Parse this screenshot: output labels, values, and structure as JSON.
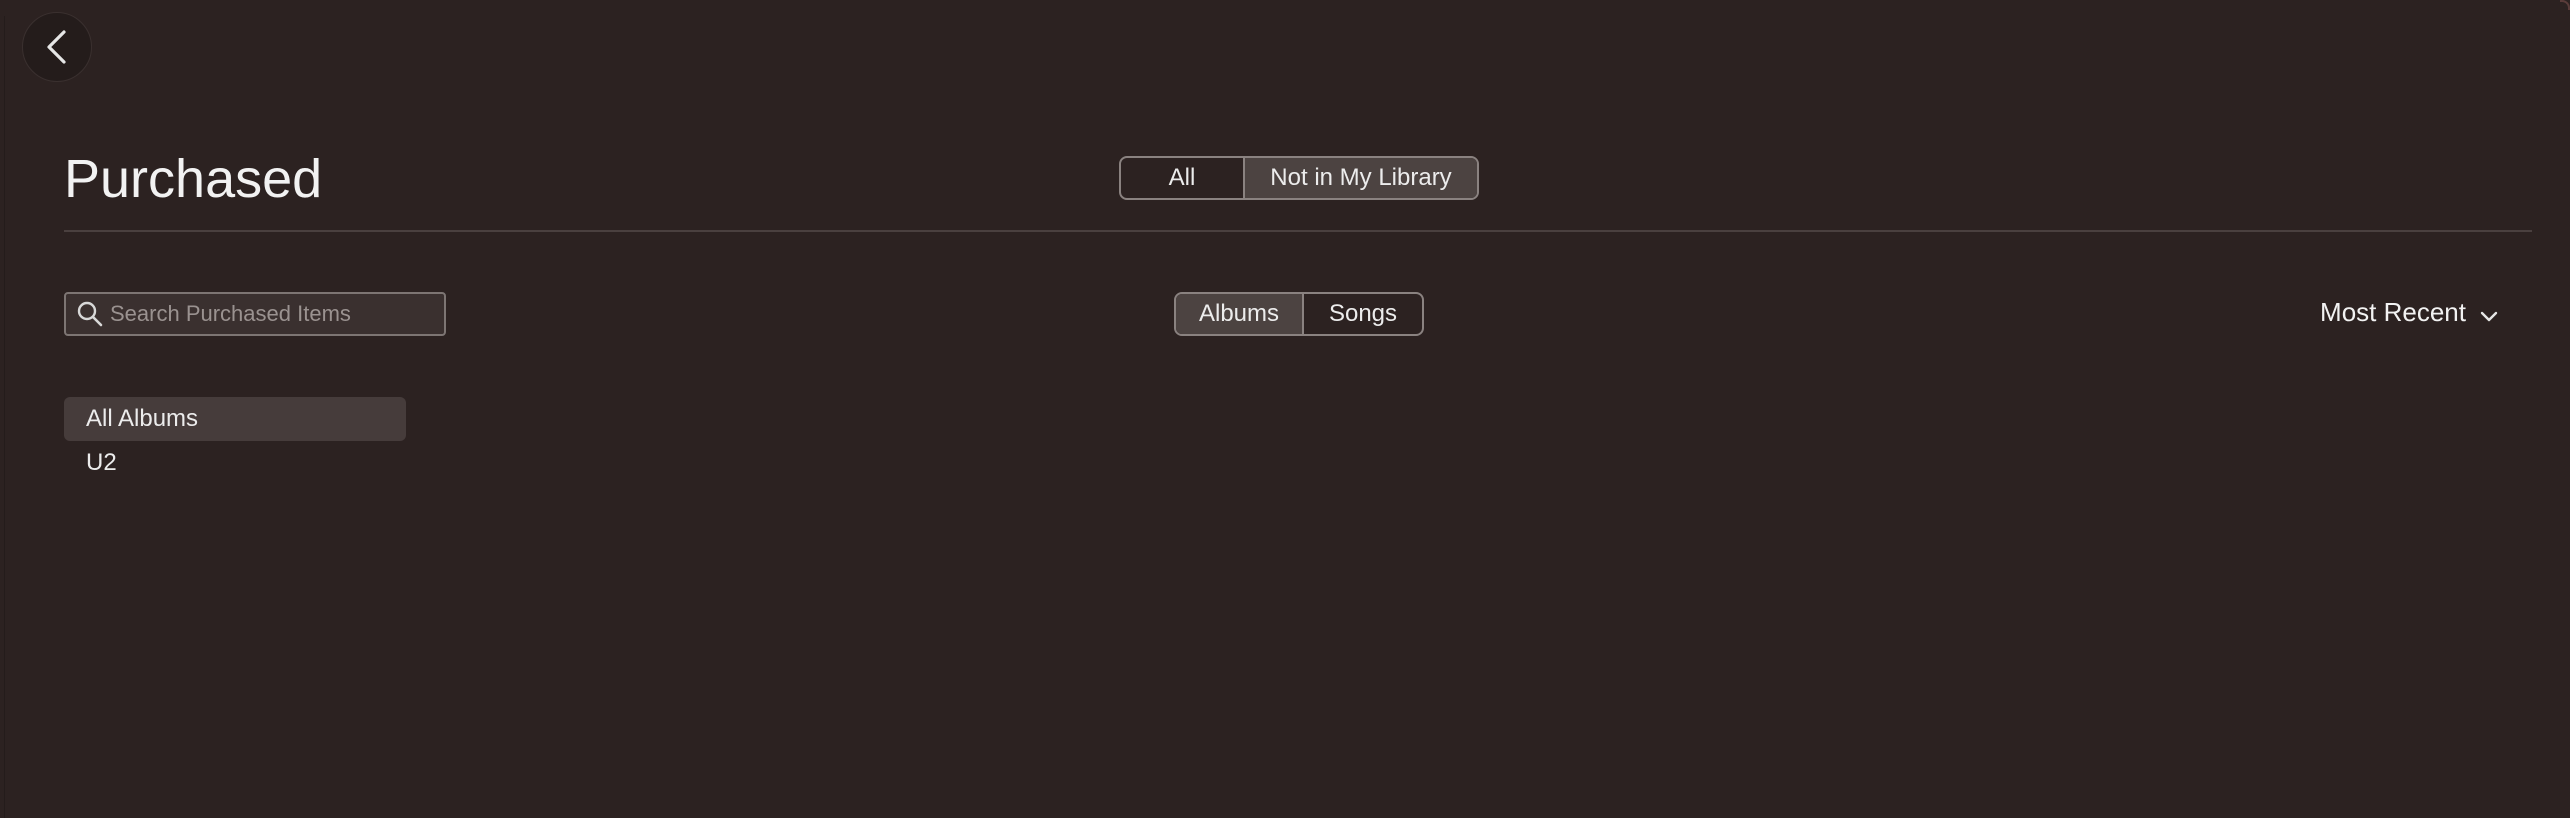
{
  "header": {
    "back_label": "Back",
    "title": "Purchased"
  },
  "library_filter": {
    "options": [
      {
        "label": "All",
        "selected": false
      },
      {
        "label": "Not in My Library",
        "selected": true
      }
    ]
  },
  "search": {
    "placeholder": "Search Purchased Items",
    "value": ""
  },
  "kind_filter": {
    "options": [
      {
        "label": "Albums",
        "selected": true
      },
      {
        "label": "Songs",
        "selected": false
      }
    ]
  },
  "sort": {
    "label": "Most Recent",
    "icon": "chevron-down-icon"
  },
  "artists": [
    {
      "label": "All Albums",
      "selected": true
    },
    {
      "label": "U2",
      "selected": false
    }
  ],
  "colors": {
    "background": "#2c2221",
    "segment_active": "#4c4341",
    "list_selected": "#463c3b"
  }
}
